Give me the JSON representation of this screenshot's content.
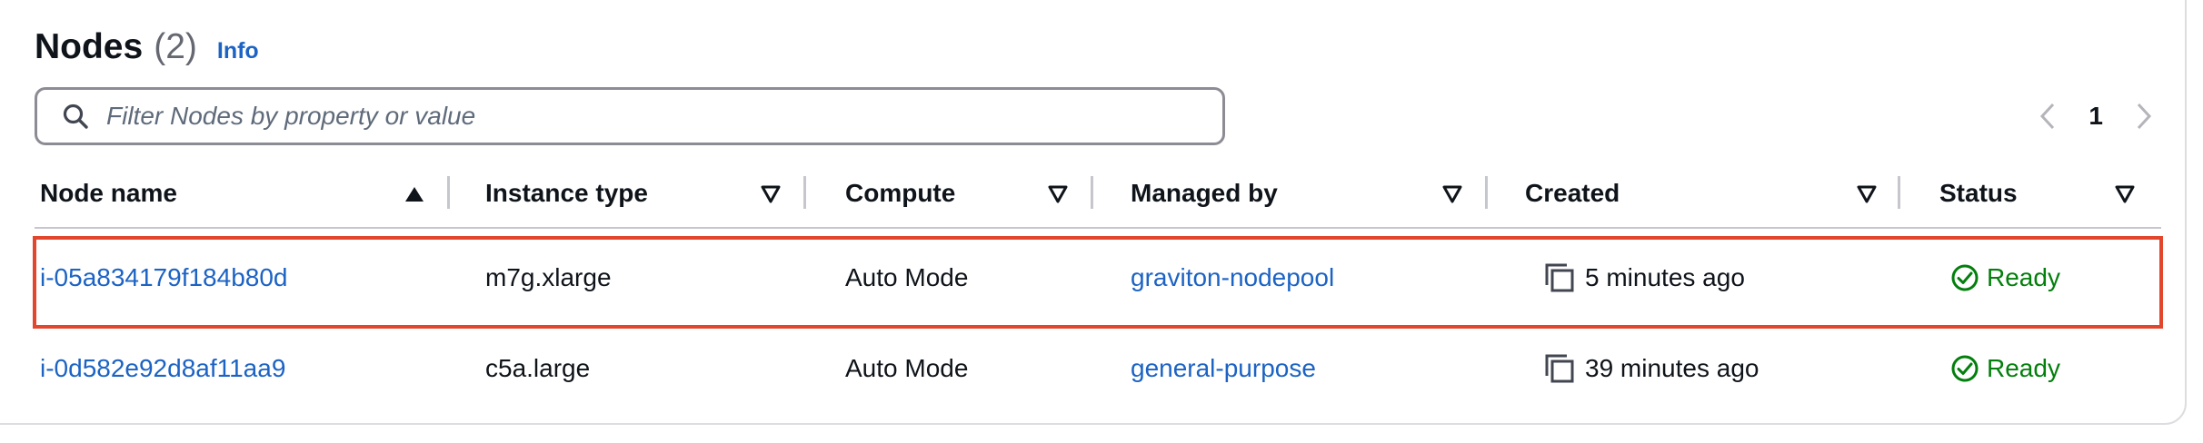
{
  "header": {
    "title": "Nodes",
    "count": "(2)",
    "info_label": "Info"
  },
  "filter": {
    "placeholder": "Filter Nodes by property or value",
    "icon": "search-icon"
  },
  "pagination": {
    "current_page": "1"
  },
  "table": {
    "columns": [
      "Node name",
      "Instance type",
      "Compute",
      "Managed by",
      "Created",
      "Status"
    ],
    "sorted_column": "Node name",
    "sort_direction": "ascending",
    "rows": [
      {
        "node_name": "i-05a834179f184b80d",
        "instance_type": "m7g.xlarge",
        "compute": "Auto Mode",
        "managed_by": "graviton-nodepool",
        "created": "5 minutes ago",
        "status": "Ready",
        "selected": true
      },
      {
        "node_name": "i-0d582e92d8af11aa9",
        "instance_type": "c5a.large",
        "compute": "Auto Mode",
        "managed_by": "general-purpose",
        "created": "39 minutes ago",
        "status": "Ready",
        "selected": false
      }
    ]
  },
  "colors": {
    "link": "#1c63c4",
    "ready": "#037f0c",
    "selection_outline": "#e2462d"
  }
}
